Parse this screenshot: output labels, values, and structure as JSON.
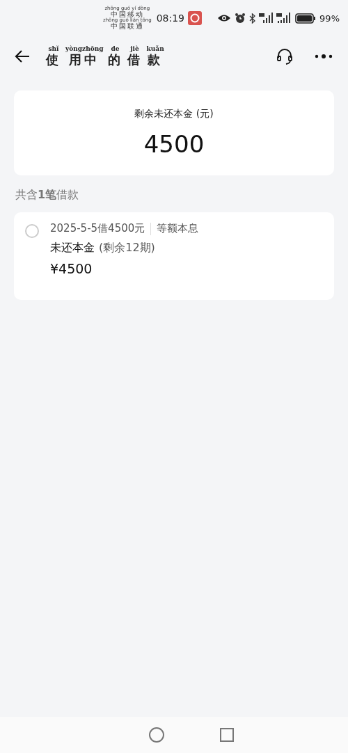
{
  "status_bar": {
    "carriers": [
      {
        "pinyin": "zhōng guó yí dòng",
        "name": "中国移动"
      },
      {
        "pinyin": "zhōng guó lián tōng",
        "name": "中国联通"
      }
    ],
    "time": "08:19",
    "battery": "99%"
  },
  "header": {
    "title": [
      {
        "pinyin": "shǐ",
        "text": "使"
      },
      {
        "pinyin": "yòngzhōng",
        "text": "用中"
      },
      {
        "pinyin": "de",
        "text": "的"
      },
      {
        "pinyin": "jiè",
        "text": "借"
      },
      {
        "pinyin": "kuǎn",
        "text": "款"
      }
    ]
  },
  "summary": {
    "label": "剩余未还本金 (元)",
    "amount": "4500"
  },
  "count_label": "共含**1笔**借款",
  "loans": [
    {
      "selected": false,
      "title": "2025-5-5借4500元",
      "method": "等额本息",
      "principal_label": "未还本金",
      "remaining": "(剩余12期)",
      "amount": "¥4500"
    }
  ]
}
